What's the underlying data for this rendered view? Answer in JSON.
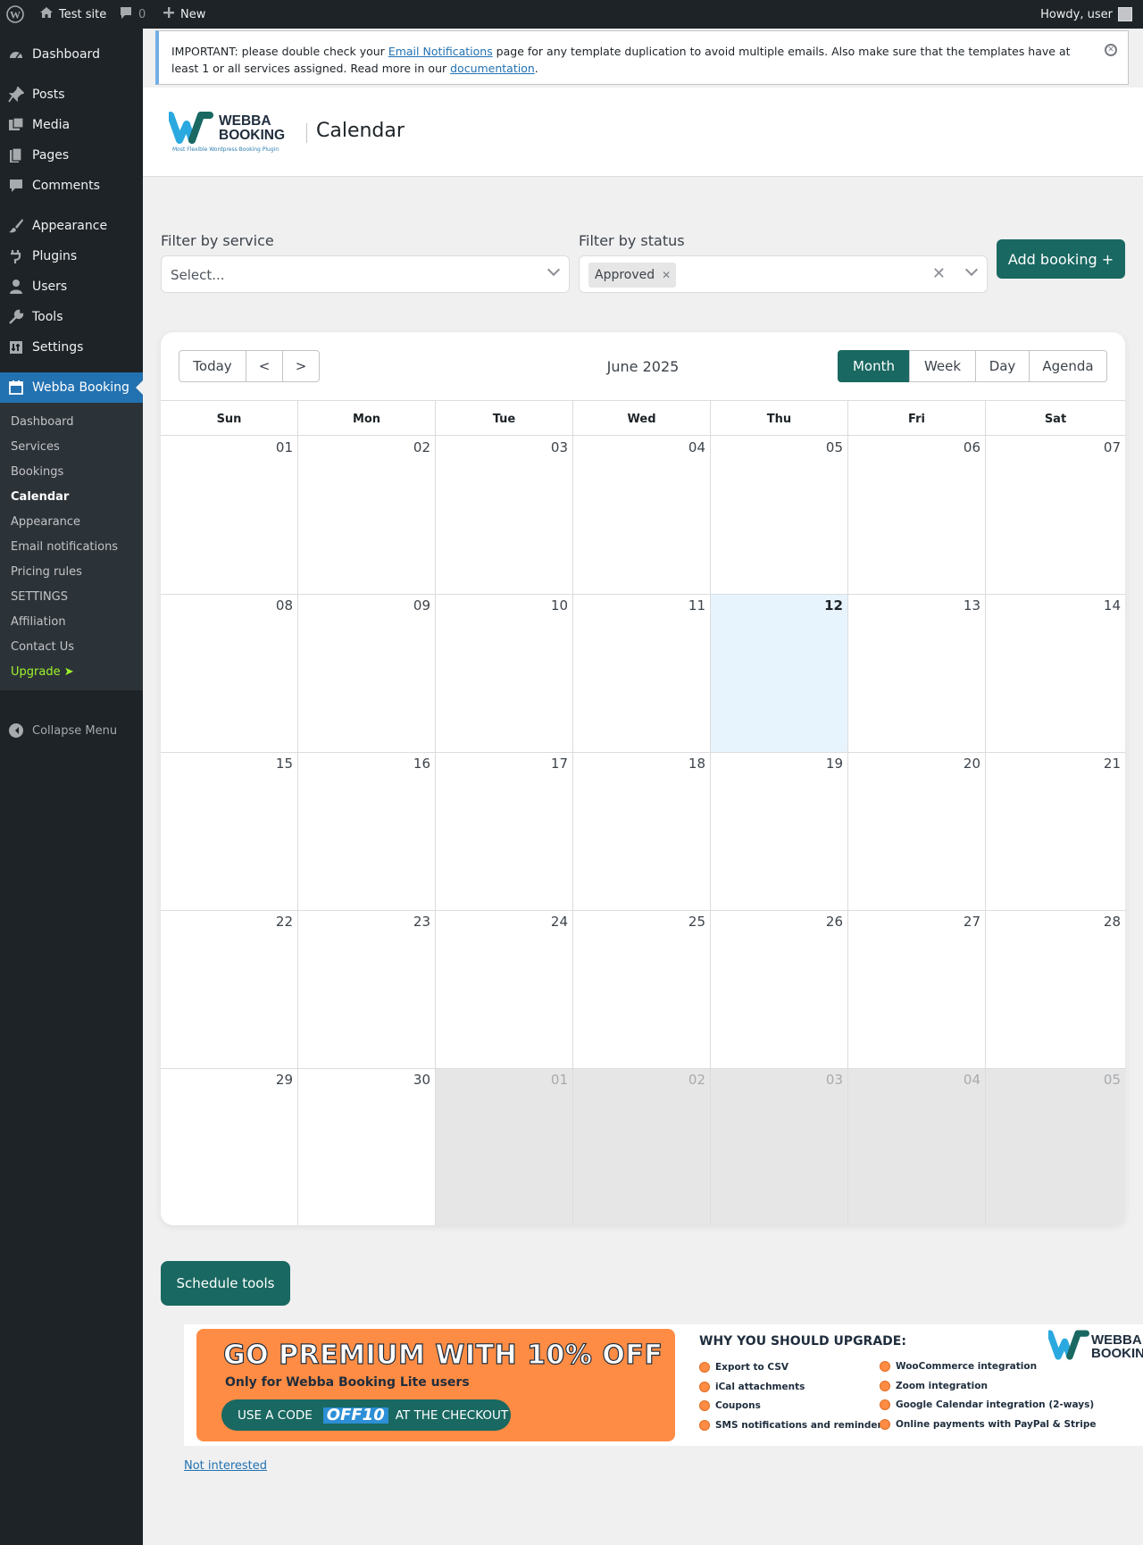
{
  "admin_bar": {
    "site_name": "Test site",
    "comments_count": "0",
    "new_label": "New",
    "howdy": "Howdy, user"
  },
  "sidebar": {
    "items": [
      {
        "label": "Dashboard",
        "icon": "dashboard-icon"
      },
      {
        "label": "Posts",
        "icon": "pin-icon"
      },
      {
        "label": "Media",
        "icon": "media-icon"
      },
      {
        "label": "Pages",
        "icon": "pages-icon"
      },
      {
        "label": "Comments",
        "icon": "comment-icon"
      },
      {
        "label": "Appearance",
        "icon": "brush-icon"
      },
      {
        "label": "Plugins",
        "icon": "plug-icon"
      },
      {
        "label": "Users",
        "icon": "user-icon"
      },
      {
        "label": "Tools",
        "icon": "wrench-icon"
      },
      {
        "label": "Settings",
        "icon": "settings-icon"
      },
      {
        "label": "Webba Booking",
        "icon": "calendar-icon"
      }
    ],
    "submenu": [
      "Dashboard",
      "Services",
      "Bookings",
      "Calendar",
      "Appearance",
      "Email notifications",
      "Pricing rules",
      "SETTINGS",
      "Affiliation",
      "Contact Us",
      "Upgrade ➤"
    ],
    "collapse_label": "Collapse Menu"
  },
  "notice": {
    "text_1": "IMPORTANT: please double check your ",
    "link_1": "Email Notifications",
    "text_2": " page for any template duplication to avoid multiple emails. Also make sure that the templates have at least 1 or all services assigned. Read more in our ",
    "link_2": "documentation",
    "text_3": "."
  },
  "header": {
    "logo_name_1": "WEBBA",
    "logo_name_2": "BOOKING",
    "logo_tagline": "Most Flexible Wordpress Booking Plugin",
    "page_title": "Calendar"
  },
  "filters": {
    "service_label": "Filter by service",
    "service_placeholder": "Select...",
    "status_label": "Filter by status",
    "status_chip": "Approved",
    "add_booking": "Add booking +"
  },
  "calendar": {
    "today_label": "Today",
    "prev_label": "<",
    "next_label": ">",
    "month_label": "June 2025",
    "views": [
      "Month",
      "Week",
      "Day",
      "Agenda"
    ],
    "active_view": "Month",
    "days_of_week": [
      "Sun",
      "Mon",
      "Tue",
      "Wed",
      "Thu",
      "Fri",
      "Sat"
    ],
    "weeks": [
      [
        "01",
        "02",
        "03",
        "04",
        "05",
        "06",
        "07"
      ],
      [
        "08",
        "09",
        "10",
        "11",
        "12",
        "13",
        "14"
      ],
      [
        "15",
        "16",
        "17",
        "18",
        "19",
        "20",
        "21"
      ],
      [
        "22",
        "23",
        "24",
        "25",
        "26",
        "27",
        "28"
      ],
      [
        "29",
        "30",
        "01",
        "02",
        "03",
        "04",
        "05"
      ]
    ],
    "today_date": "12"
  },
  "schedule_tools": "Schedule tools",
  "banner": {
    "headline": "GO PREMIUM WITH 10% OFF",
    "subline": "Only for Webba Booking Lite users",
    "code_prefix": "USE A CODE",
    "code": "OFF10",
    "code_suffix": "AT THE CHECKOUT",
    "why_title": "WHY YOU SHOULD UPGRADE:",
    "features_left": [
      "Export to CSV",
      "iCal attachments",
      "Coupons",
      "SMS notifications and reminders"
    ],
    "features_right": [
      "WooCommerce integration",
      "Zoom integration",
      "Google Calendar integration (2-ways)",
      "Online payments with PayPal & Stripe"
    ],
    "logo_name_1": "WEBBA",
    "logo_name_2": "BOOKING"
  },
  "not_interested": "Not interested",
  "colors": {
    "accent": "#196861",
    "wp_blue": "#2271b1",
    "sidebar_bg": "#1d2327",
    "banner_orange": "#ff8c44",
    "today_bg": "#e8f4fd"
  }
}
